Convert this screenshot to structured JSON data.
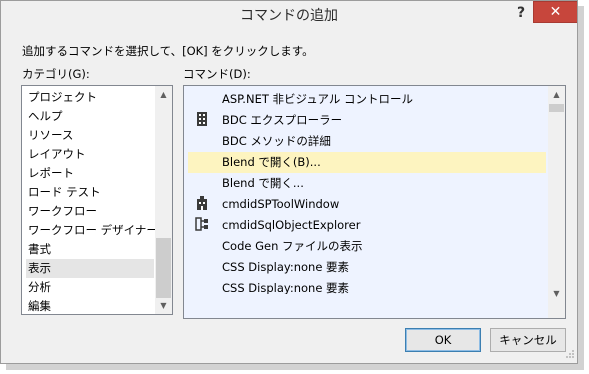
{
  "window": {
    "title": "コマンドの追加",
    "help_label": "?",
    "close_label": "✕"
  },
  "instruction": "追加するコマンドを選択して、[OK] をクリックします。",
  "categories": {
    "label": "カテゴリ(G):",
    "selected": "表示",
    "items": [
      {
        "label": "プロジェクト"
      },
      {
        "label": "ヘルプ"
      },
      {
        "label": "リソース"
      },
      {
        "label": "レイアウト"
      },
      {
        "label": "レポート"
      },
      {
        "label": "ロード テスト"
      },
      {
        "label": "ワークフロー"
      },
      {
        "label": "ワークフロー デザイナー"
      },
      {
        "label": "書式"
      },
      {
        "label": "表示"
      },
      {
        "label": "分析"
      },
      {
        "label": "編集"
      }
    ]
  },
  "commands": {
    "label": "コマンド(D):",
    "highlighted": "Blend で開く(B)...",
    "items": [
      {
        "label": "ASP.NET 非ビジュアル コントロール",
        "icon": ""
      },
      {
        "label": "BDC エクスプローラー",
        "icon": "server-icon"
      },
      {
        "label": "BDC メソッドの詳細",
        "icon": ""
      },
      {
        "label": "Blend で開く(B)...",
        "icon": ""
      },
      {
        "label": "Blend で開く...",
        "icon": ""
      },
      {
        "label": "cmdidSPToolWindow",
        "icon": "sharepoint-tool-icon"
      },
      {
        "label": "cmdidSqlObjectExplorer",
        "icon": "sql-object-explorer-icon"
      },
      {
        "label": "Code Gen ファイルの表示",
        "icon": ""
      },
      {
        "label": "CSS Display:none 要素",
        "icon": ""
      },
      {
        "label": "CSS Display:none 要素",
        "icon": ""
      }
    ]
  },
  "buttons": {
    "ok": "OK",
    "cancel": "キャンセル"
  },
  "colors": {
    "close_button": "#c7463c",
    "highlight": "#fdf4c0",
    "command_list_bg": "#eef3ff",
    "ok_border": "#3c7fb1"
  }
}
